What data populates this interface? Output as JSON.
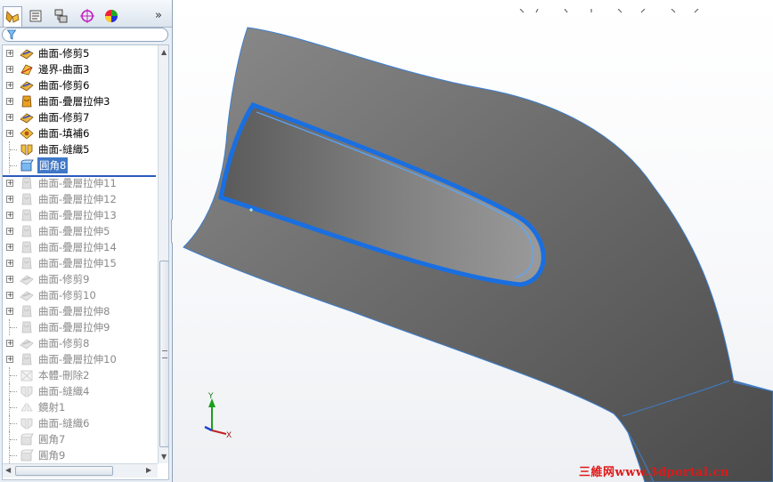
{
  "panel": {
    "tabs": [
      {
        "icon": "feature-manager-icon",
        "active": true
      },
      {
        "icon": "property-manager-icon"
      },
      {
        "icon": "configuration-manager-icon"
      },
      {
        "icon": "dimxpert-icon"
      },
      {
        "icon": "display-manager-icon"
      }
    ],
    "more_label": "»",
    "filter_icon": "filter-icon"
  },
  "tree": {
    "items": [
      {
        "label": "曲面-修剪5",
        "icon": "trim-surface-icon",
        "expandable": true,
        "suppressed": false
      },
      {
        "label": "邊界-曲面3",
        "icon": "boundary-surface-icon",
        "expandable": true,
        "suppressed": false
      },
      {
        "label": "曲面-修剪6",
        "icon": "trim-surface-icon",
        "expandable": true,
        "suppressed": false
      },
      {
        "label": "曲面-疊層拉伸3",
        "icon": "loft-surface-icon",
        "expandable": true,
        "suppressed": false
      },
      {
        "label": "曲面-修剪7",
        "icon": "trim-surface-icon",
        "expandable": true,
        "suppressed": false
      },
      {
        "label": "曲面-填補6",
        "icon": "fill-surface-icon",
        "expandable": true,
        "suppressed": false
      },
      {
        "label": "曲面-縫織5",
        "icon": "knit-surface-icon",
        "expandable": false,
        "suppressed": false
      },
      {
        "label": "圓角8",
        "icon": "fillet-icon",
        "expandable": false,
        "suppressed": false,
        "selected": true
      },
      {
        "label": "曲面-疊層拉伸11",
        "icon": "loft-surface-icon",
        "expandable": true,
        "suppressed": true
      },
      {
        "label": "曲面-疊層拉伸12",
        "icon": "loft-surface-icon",
        "expandable": true,
        "suppressed": true
      },
      {
        "label": "曲面-疊層拉伸13",
        "icon": "loft-surface-icon",
        "expandable": true,
        "suppressed": true
      },
      {
        "label": "曲面-疊層拉伸5",
        "icon": "loft-surface-icon",
        "expandable": true,
        "suppressed": true
      },
      {
        "label": "曲面-疊層拉伸14",
        "icon": "loft-surface-icon",
        "expandable": true,
        "suppressed": true
      },
      {
        "label": "曲面-疊層拉伸15",
        "icon": "loft-surface-icon",
        "expandable": true,
        "suppressed": true
      },
      {
        "label": "曲面-修剪9",
        "icon": "trim-surface-icon",
        "expandable": true,
        "suppressed": true
      },
      {
        "label": "曲面-修剪10",
        "icon": "trim-surface-icon",
        "expandable": true,
        "suppressed": true
      },
      {
        "label": "曲面-疊層拉伸8",
        "icon": "loft-surface-icon",
        "expandable": true,
        "suppressed": true
      },
      {
        "label": "曲面-疊層拉伸9",
        "icon": "loft-surface-icon",
        "expandable": false,
        "suppressed": true
      },
      {
        "label": "曲面-修剪8",
        "icon": "trim-surface-icon",
        "expandable": true,
        "suppressed": true
      },
      {
        "label": "曲面-疊層拉伸10",
        "icon": "loft-surface-icon",
        "expandable": true,
        "suppressed": true
      },
      {
        "label": "本體-刪除2",
        "icon": "delete-body-icon",
        "expandable": false,
        "suppressed": true
      },
      {
        "label": "曲面-縫織4",
        "icon": "knit-surface-icon",
        "expandable": false,
        "suppressed": true
      },
      {
        "label": "鏡射1",
        "icon": "mirror-icon",
        "expandable": false,
        "suppressed": true
      },
      {
        "label": "曲面-縫織6",
        "icon": "knit-surface-icon",
        "expandable": false,
        "suppressed": true
      },
      {
        "label": "圓角7",
        "icon": "fillet-icon",
        "expandable": false,
        "suppressed": true
      },
      {
        "label": "圓角9",
        "icon": "fillet-icon",
        "expandable": false,
        "suppressed": true
      }
    ]
  },
  "viewport": {
    "triad": {
      "y_label": "Y",
      "x_label": "X"
    },
    "watermark": "三維网www.3dportal.cn"
  },
  "colors": {
    "selection": "#3f78c7",
    "edge_highlight": "#1a6fe0",
    "rollback_bar": "#2a5bbd",
    "watermark": "#e01818"
  }
}
